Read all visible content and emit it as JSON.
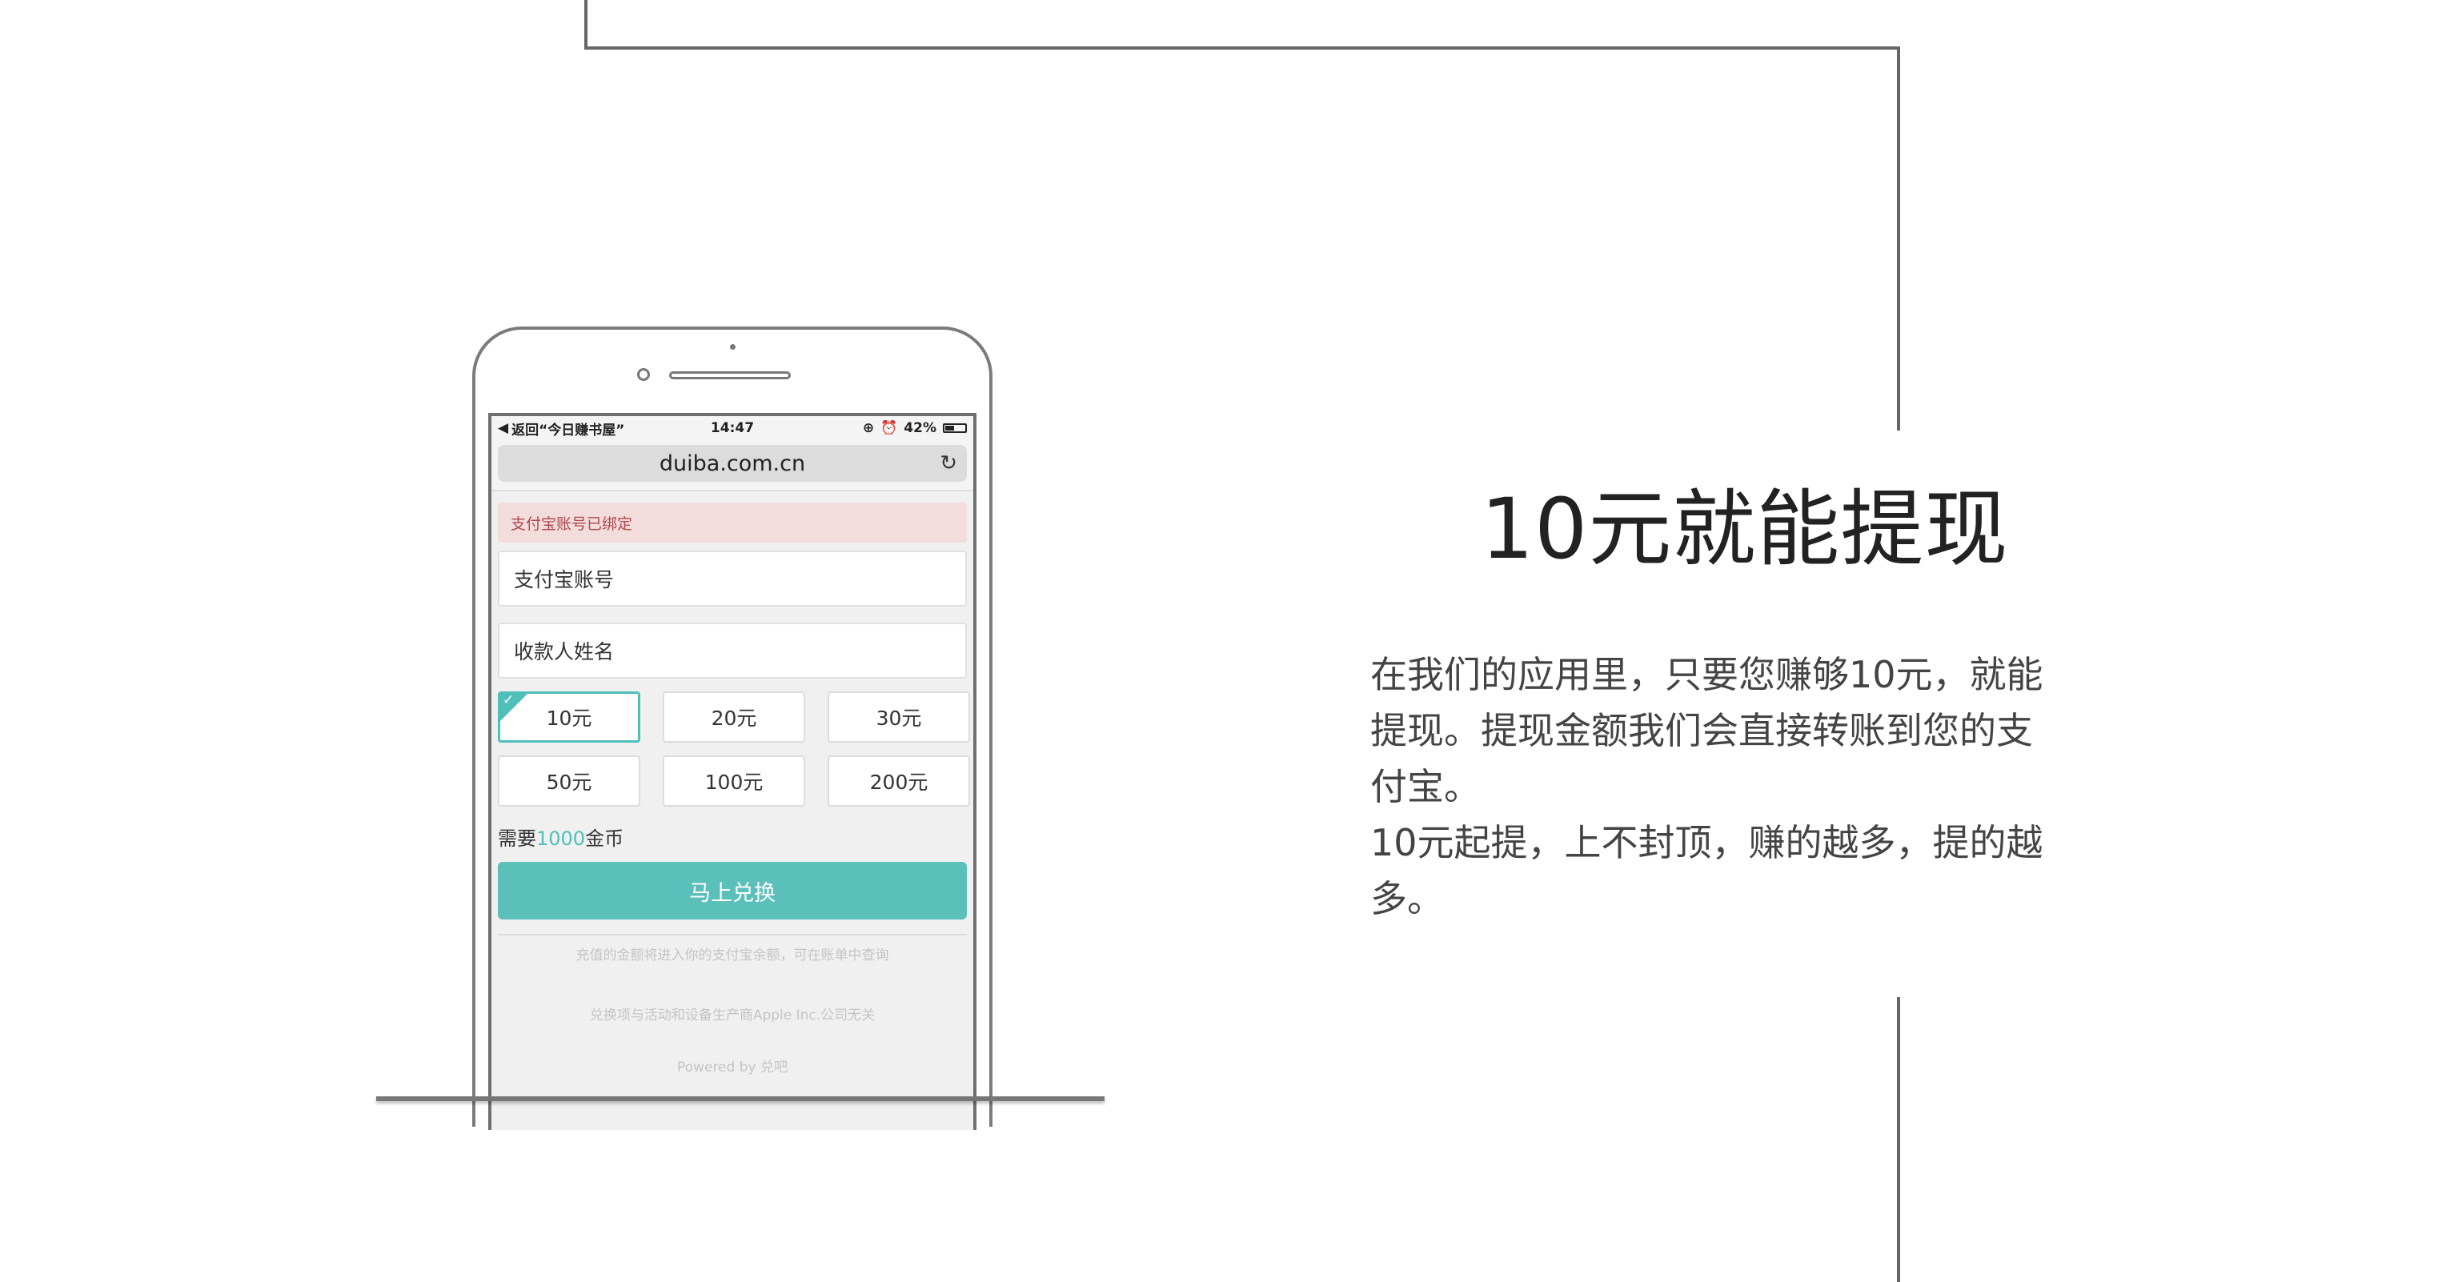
{
  "phone": {
    "status": {
      "back": "返回“今日赚书屋”",
      "time": "14:47",
      "battery": "42%"
    },
    "url": "duiba.com.cn",
    "notice": "支付宝账号已绑定",
    "fields": {
      "account": "支付宝账号",
      "name": "收款人姓名"
    },
    "amounts": [
      "10元",
      "20元",
      "30元",
      "50元",
      "100元",
      "200元"
    ],
    "selected_amount": "10元",
    "need": {
      "prefix": "需要",
      "coins": "1000",
      "suffix": "金币"
    },
    "exchange_button": "马上兑换",
    "fine_print": [
      "充值的金额将进入你的支付宝余额，可在账单中查询",
      "兑换项与活动和设备生产商Apple Inc.公司无关",
      "Powered by 兑吧"
    ]
  },
  "title": "10元就能提现",
  "description": [
    "在我们的应用里，只要您赚够10元，就能",
    "提现。提现金额我们会直接转账到您的支",
    "付宝。",
    "10元起提，上不封顶，赚的越多，提的越",
    "多。"
  ]
}
